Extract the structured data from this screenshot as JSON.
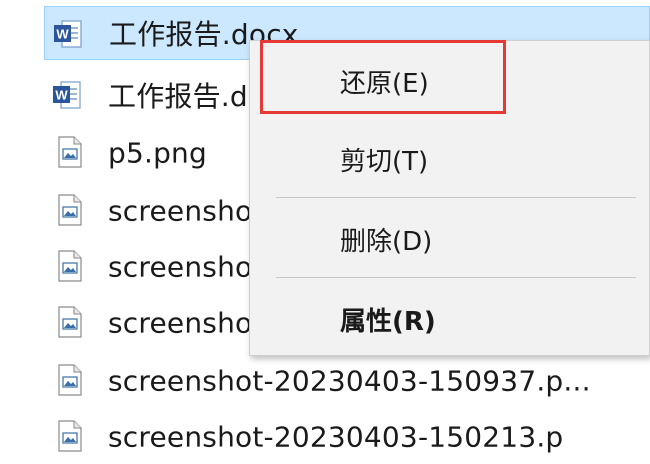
{
  "files": [
    {
      "name": "工作报告.docx",
      "icon": "word-doc-icon",
      "selected": true
    },
    {
      "name": "工作报告.d",
      "icon": "word-doc-icon",
      "selected": false
    },
    {
      "name": "p5.png",
      "icon": "image-file-icon",
      "selected": false
    },
    {
      "name": "screensho",
      "icon": "image-file-icon",
      "selected": false
    },
    {
      "name": "screensho",
      "icon": "image-file-icon",
      "selected": false
    },
    {
      "name": "screensho",
      "icon": "image-file-icon",
      "selected": false
    },
    {
      "name": "screenshot-20230403-150937.p...",
      "icon": "image-file-icon",
      "selected": false
    },
    {
      "name": "screenshot-20230403-150213.p",
      "icon": "image-file-icon",
      "selected": false
    }
  ],
  "context_menu": {
    "items": [
      {
        "label": "还原(E)",
        "bold": false
      },
      {
        "label": "剪切(T)",
        "bold": false
      },
      {
        "label": "删除(D)",
        "bold": false
      },
      {
        "label": "属性(R)",
        "bold": true
      }
    ]
  },
  "colors": {
    "selection_bg": "#cce8ff",
    "highlight_border": "#e53935",
    "word_blue": "#2b579a"
  }
}
